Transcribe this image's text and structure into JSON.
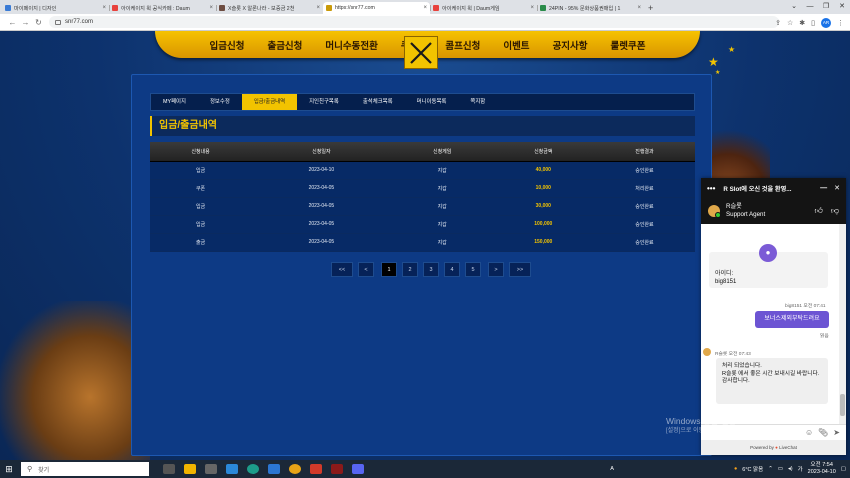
{
  "browser": {
    "tabs": [
      {
        "label": "마이페이지 | 디자인",
        "color": "#3a7bd5",
        "active": false
      },
      {
        "label": "아이케이지 윅 공식카페 : Daum",
        "color": "#e8413c",
        "active": false
      },
      {
        "label": "X슬롯 X 알론나라 - 보증금 2천",
        "color": "#6d4c41",
        "active": false
      },
      {
        "label": "https://snr77.com",
        "color": "#c99a0a",
        "active": true
      },
      {
        "label": "아이케이지 윅 | Daum게임",
        "color": "#e8413c",
        "active": false
      },
      {
        "label": "24PIN - 95% 문화상품권매입 | 1",
        "color": "#2a8c4a",
        "active": false
      }
    ],
    "new_tab": "+",
    "url": "snr77.com",
    "profile_initials": "AR",
    "win_controls": [
      "⌄",
      "—",
      "❐",
      "✕"
    ],
    "nav_icons": [
      "back-arrow-icon",
      "forward-arrow-icon",
      "reload-icon"
    ]
  },
  "site": {
    "topnav": [
      "입금신청",
      "출금신청",
      "머니수동전환",
      "쿠폰",
      "콤프신청",
      "이벤트",
      "공지사항",
      "룰렛쿠폰"
    ],
    "subnav": [
      "MY페이지",
      "정보수정",
      "입금/출금내역",
      "지인친구목록",
      "출석체크목록",
      "머니이동목록",
      "쪽지함"
    ],
    "subnav_active": 2,
    "section_title": "입금/출금내역",
    "table": {
      "headers": [
        "신청내용",
        "신청일자",
        "신청게임",
        "신청금액",
        "진행결과"
      ],
      "rows": [
        [
          "입금",
          "2023-04-10",
          "지갑",
          "40,000",
          "승인완료"
        ],
        [
          "쿠폰",
          "2023-04-05",
          "지갑",
          "10,000",
          "처리완료"
        ],
        [
          "입금",
          "2023-04-05",
          "지갑",
          "30,000",
          "승인완료"
        ],
        [
          "입금",
          "2023-04-05",
          "지갑",
          "100,000",
          "승인완료"
        ],
        [
          "출금",
          "2023-04-05",
          "지갑",
          "150,000",
          "승인완료"
        ]
      ]
    },
    "pagination": {
      "first": "<<",
      "prev": "<",
      "pages": [
        "1",
        "2",
        "3",
        "4",
        "5"
      ],
      "current": "1",
      "next": ">",
      "last": ">>"
    }
  },
  "chat": {
    "header_title": "R Slot에 오신 것을 환영...",
    "agent_name": "R슬롯",
    "agent_role": "Support Agent",
    "info_label": "아이디:",
    "info_value": "big8151",
    "user_meta": "big8151 오전 07:41",
    "user_message": "보너스제외부탁드려요",
    "read_label": "읽음",
    "agent_meta": "R슬롯 오전 07:43",
    "agent_message": [
      "처리 되었습니다.",
      "R슬롯 에서 좋은 시간 보내시길 바랍니다.",
      "감사합니다."
    ],
    "powered_by": "Powered by",
    "powered_brand": "LiveChat"
  },
  "os": {
    "watermark_title": "Windows 정품 인증",
    "watermark_sub": "[설정]으로 이동하여 Windows를 정품 인증합니다.",
    "search_placeholder": "찾기",
    "weather": "6°C 맑음",
    "time": "오전 7:54",
    "date": "2023-04-10",
    "ime": "A"
  }
}
